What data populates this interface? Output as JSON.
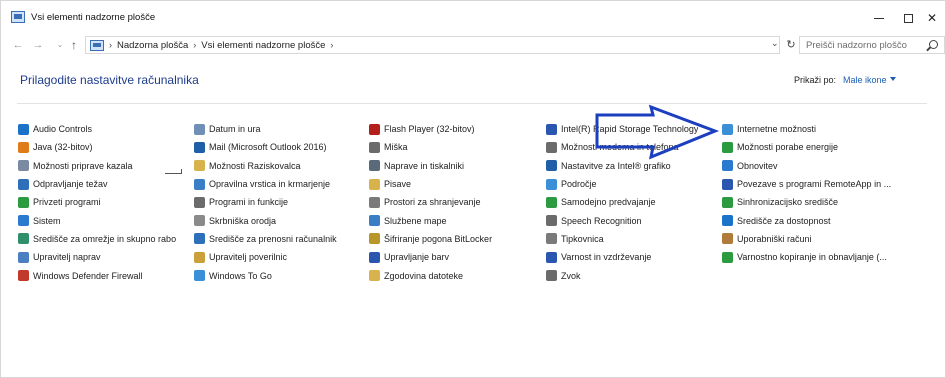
{
  "window": {
    "title": "Vsi elementi nadzorne plošče"
  },
  "address": {
    "crumbs": [
      "Nadzorna plošča",
      "Vsi elementi nadzorne plošče"
    ],
    "search_placeholder": "Preišči nadzorno ploščo"
  },
  "content": {
    "title": "Prilagodite nastavitve računalnika",
    "view_by_label": "Prikaži po:",
    "view_by_value": "Male ikone"
  },
  "columns": [
    {
      "items": [
        {
          "label": "Audio Controls",
          "icon": "audio-controls-icon",
          "color": "#1a73c8"
        },
        {
          "label": "Java (32-bitov)",
          "icon": "java-icon",
          "color": "#e07b1a"
        },
        {
          "label": "Možnosti priprave kazala",
          "icon": "indexing-options-icon",
          "color": "#7a8aa0"
        },
        {
          "label": "Odpravljanje težav",
          "icon": "troubleshooting-icon",
          "color": "#2d6fb8"
        },
        {
          "label": "Privzeti programi",
          "icon": "default-programs-icon",
          "color": "#2c9a3e"
        },
        {
          "label": "Sistem",
          "icon": "system-icon",
          "color": "#2a7bd0"
        },
        {
          "label": "Središče za omrežje in skupno rabo",
          "icon": "network-center-icon",
          "color": "#2f8f6a"
        },
        {
          "label": "Upravitelj naprav",
          "icon": "device-manager-icon",
          "color": "#4a7fc1"
        },
        {
          "label": "Windows Defender Firewall",
          "icon": "firewall-icon",
          "color": "#c0392b"
        }
      ]
    },
    {
      "items": [
        {
          "label": "Datum in ura",
          "icon": "date-time-icon",
          "color": "#6f8fb7"
        },
        {
          "label": "Mail (Microsoft Outlook 2016)",
          "icon": "mail-icon",
          "color": "#1f5fa8"
        },
        {
          "label": "Možnosti Raziskovalca",
          "icon": "explorer-options-icon",
          "color": "#d8b24a"
        },
        {
          "label": "Opravilna vrstica in krmarjenje",
          "icon": "taskbar-icon",
          "color": "#3a7ec6"
        },
        {
          "label": "Programi in funkcije",
          "icon": "programs-features-icon",
          "color": "#6b6b6b"
        },
        {
          "label": "Skrbniška orodja",
          "icon": "admin-tools-icon",
          "color": "#8a8a8a"
        },
        {
          "label": "Središče za prenosni računalnik",
          "icon": "mobility-center-icon",
          "color": "#2d6fb8"
        },
        {
          "label": "Upravitelj poverilnic",
          "icon": "credential-manager-icon",
          "color": "#c9a03a"
        },
        {
          "label": "Windows To Go",
          "icon": "windows-to-go-icon",
          "color": "#3a8fd6"
        }
      ]
    },
    {
      "items": [
        {
          "label": "Flash Player (32-bitov)",
          "icon": "flash-player-icon",
          "color": "#b3201c"
        },
        {
          "label": "Miška",
          "icon": "mouse-icon",
          "color": "#6b6b6b"
        },
        {
          "label": "Naprave in tiskalniki",
          "icon": "devices-printers-icon",
          "color": "#5a6a7a"
        },
        {
          "label": "Pisave",
          "icon": "fonts-icon",
          "color": "#d8b24a"
        },
        {
          "label": "Prostori za shranjevanje",
          "icon": "storage-spaces-icon",
          "color": "#7a7a7a"
        },
        {
          "label": "Službene mape",
          "icon": "work-folders-icon",
          "color": "#3a7ec6"
        },
        {
          "label": "Šifriranje pogona BitLocker",
          "icon": "bitlocker-icon",
          "color": "#b8962a"
        },
        {
          "label": "Upravljanje barv",
          "icon": "color-management-icon",
          "color": "#2a56b0"
        },
        {
          "label": "Zgodovina datoteke",
          "icon": "file-history-icon",
          "color": "#d8b24a"
        }
      ]
    },
    {
      "items": [
        {
          "label": "Intel(R) Rapid Storage Technology",
          "icon": "intel-rst-icon",
          "color": "#2a56b0"
        },
        {
          "label": "Možnosti modema in telefona",
          "icon": "modem-phone-icon",
          "color": "#6b6b6b"
        },
        {
          "label": "Nastavitve za Intel® grafiko",
          "icon": "intel-graphics-icon",
          "color": "#1f5fa8"
        },
        {
          "label": "Področje",
          "icon": "region-icon",
          "color": "#3a8fd6"
        },
        {
          "label": "Samodejno predvajanje",
          "icon": "autoplay-icon",
          "color": "#2c9a3e"
        },
        {
          "label": "Speech Recognition",
          "icon": "speech-recognition-icon",
          "color": "#6b6b6b"
        },
        {
          "label": "Tipkovnica",
          "icon": "keyboard-icon",
          "color": "#7a7a7a"
        },
        {
          "label": "Varnost in vzdrževanje",
          "icon": "security-maintenance-icon",
          "color": "#2a56b0"
        },
        {
          "label": "Zvok",
          "icon": "sound-icon",
          "color": "#6b6b6b"
        }
      ]
    },
    {
      "items": [
        {
          "label": "Internetne možnosti",
          "icon": "internet-options-icon",
          "color": "#3a8fd6"
        },
        {
          "label": "Možnosti porabe energije",
          "icon": "power-options-icon",
          "color": "#2c9a3e"
        },
        {
          "label": "Obnovitev",
          "icon": "recovery-icon",
          "color": "#2a7bd0"
        },
        {
          "label": "Povezave s programi RemoteApp in ...",
          "icon": "remoteapp-icon",
          "color": "#2a56b0"
        },
        {
          "label": "Sinhronizacijsko središče",
          "icon": "sync-center-icon",
          "color": "#2c9a3e"
        },
        {
          "label": "Središče za dostopnost",
          "icon": "ease-of-access-icon",
          "color": "#1a73c8"
        },
        {
          "label": "Uporabniški računi",
          "icon": "user-accounts-icon",
          "color": "#b07a3a"
        },
        {
          "label": "Varnostno kopiranje in obnavljanje (...",
          "icon": "backup-restore-icon",
          "color": "#2c9a3e"
        }
      ]
    }
  ],
  "annotation": {
    "arrow_color": "#1b3fbf"
  }
}
